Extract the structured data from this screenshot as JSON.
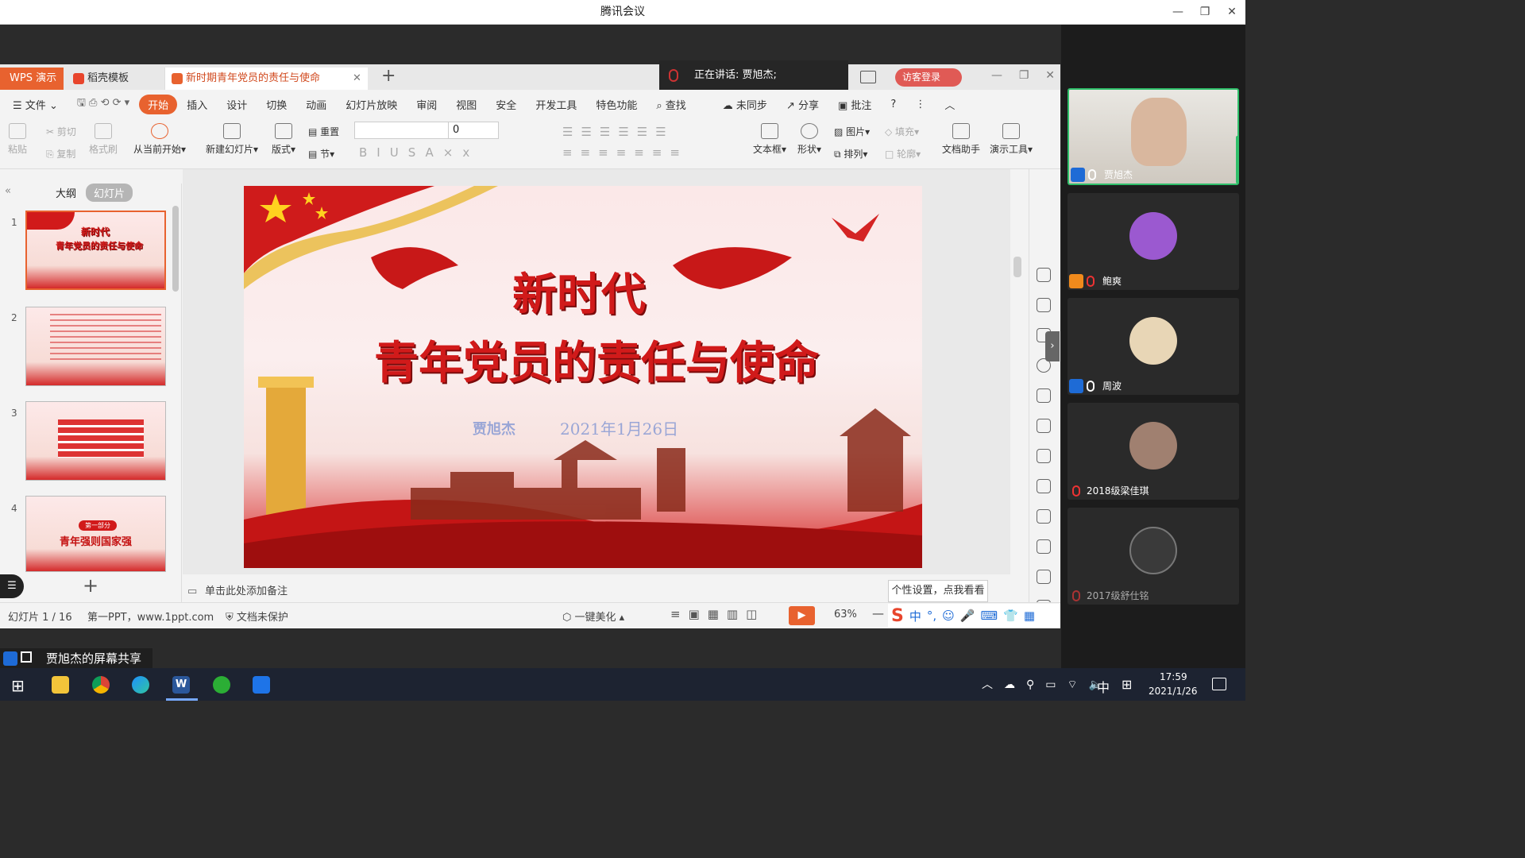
{
  "meeting": {
    "title": "腾讯会议",
    "controls": [
      "—",
      "❐",
      "✕"
    ]
  },
  "speaker_banner": {
    "text": "正在讲话: 贾旭杰;"
  },
  "login": {
    "label": "访客登录"
  },
  "tabs": {
    "app": "WPS 演示",
    "template": "稻壳模板",
    "doc": "新时期青年党员的责任与使命"
  },
  "menu": {
    "file": "文件",
    "items": [
      "开始",
      "插入",
      "设计",
      "切换",
      "动画",
      "幻灯片放映",
      "审阅",
      "视图",
      "安全",
      "开发工具",
      "特色功能"
    ],
    "search": "查找",
    "sync": "未同步",
    "share": "分享",
    "comment": "批注"
  },
  "tools": {
    "paste": "粘贴",
    "cut": "剪切",
    "copy": "复制",
    "format_painter": "格式刷",
    "play_from_current": "从当前开始",
    "new_slide": "新建幻灯片",
    "layout": "版式",
    "reset": "重置",
    "section": "节",
    "font_size": "0",
    "textbox": "文本框",
    "shape": "形状",
    "picture": "图片",
    "arrange": "排列",
    "fill": "填充",
    "outline": "轮廓",
    "doc_assistant": "文档助手",
    "present_tools": "演示工具"
  },
  "left_panel": {
    "outline_tab": "大纲",
    "slides_tab": "幻灯片",
    "slide_numbers": [
      "1",
      "2",
      "3",
      "4"
    ]
  },
  "thumbs": {
    "t1_line1": "新时代",
    "t1_line2": "青年党员的责任与使命",
    "t4_badge": "第一部分",
    "t4_title": "青年强则国家强"
  },
  "slide": {
    "title_line1": "新时代",
    "title_line2": "青年党员的责任与使命",
    "author": "贾旭杰",
    "date": "2021年1月26日"
  },
  "notes": {
    "placeholder": "单击此处添加备注"
  },
  "status": {
    "slide_counter": "幻灯片 1 / 16",
    "theme": "第一PPT，www.1ppt.com",
    "protect": "文档未保护",
    "beautify": "一键美化",
    "zoom": "63%"
  },
  "tooltip": {
    "text": "个性设置，点我看看"
  },
  "participants": [
    {
      "name": "贾旭杰",
      "avatar_color": "#c9a78f"
    },
    {
      "name": "鲍爽",
      "avatar_color": "#9b59d0"
    },
    {
      "name": "周波",
      "avatar_color": "#e8d6b6"
    },
    {
      "name": "2018级梁佳琪",
      "avatar_color": "#a08070"
    },
    {
      "name": "2017级舒仕铭",
      "avatar_color": "#3a3a3a"
    }
  ],
  "share_label": "贾旭杰的屏幕共享",
  "taskbar": {
    "time": "17:59",
    "date": "2021/1/26",
    "ime": "中"
  },
  "colors": {
    "wps_orange": "#e8622f",
    "slide_red": "#d11a1a",
    "taskbar": "#1d2331"
  }
}
